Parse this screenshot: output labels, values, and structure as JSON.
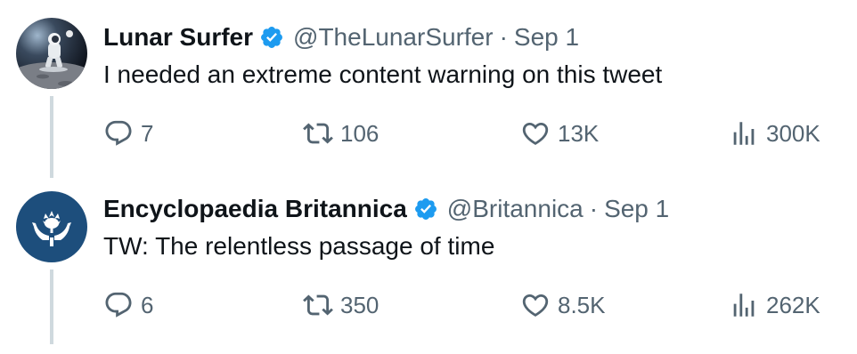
{
  "tweets": [
    {
      "name": "Lunar Surfer",
      "handle": "@TheLunarSurfer",
      "separator": "·",
      "date": "Sep 1",
      "text": "I needed an extreme content warning on this tweet",
      "replies": "7",
      "retweets": "106",
      "likes": "13K",
      "views": "300K",
      "avatar_icon": "astronaut-moon-avatar"
    },
    {
      "name": "Encyclopaedia Britannica",
      "handle": "@Britannica",
      "separator": "·",
      "date": "Sep 1",
      "text": "TW: The relentless passage of time",
      "replies": "6",
      "retweets": "350",
      "likes": "8.5K",
      "views": "262K",
      "avatar_icon": "britannica-thistle-logo",
      "avatar_color": "#1d4e7c"
    }
  ],
  "colors": {
    "verified": "#1d9bf0",
    "secondary_text": "#536471",
    "thread_line": "#cfd9de"
  }
}
